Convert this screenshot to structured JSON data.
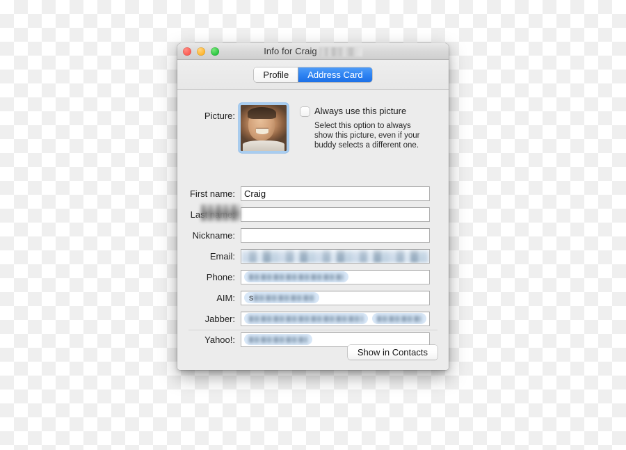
{
  "window": {
    "title_prefix": "Info for Craig",
    "title_redacted": true,
    "traffic_lights": [
      {
        "name": "close",
        "color": "#fc5b52"
      },
      {
        "name": "minimize",
        "color": "#feb52c"
      },
      {
        "name": "zoom",
        "color": "#27c53e"
      }
    ]
  },
  "tabs": [
    {
      "label": "Profile",
      "active": false
    },
    {
      "label": "Address Card",
      "active": true
    }
  ],
  "picture": {
    "label": "Picture:",
    "checkbox_label": "Always use this picture",
    "checked": false,
    "help_text": "Select this option to always show this picture, even if your buddy selects a different one."
  },
  "fields": [
    {
      "label": "First name:",
      "value": "Craig",
      "redacted": false,
      "kind": "text"
    },
    {
      "label": "Last name:",
      "value": "",
      "redacted": true,
      "kind": "overlay"
    },
    {
      "label": "Nickname:",
      "value": "",
      "redacted": false,
      "kind": "text"
    },
    {
      "label": "Email:",
      "value": "",
      "redacted": true,
      "kind": "fill"
    },
    {
      "label": "Phone:",
      "value": "",
      "redacted": true,
      "kind": "token",
      "token_width": 136
    },
    {
      "label": "AIM:",
      "value": "s",
      "redacted": true,
      "kind": "token",
      "token_width": 94
    },
    {
      "label": "Jabber:",
      "value": "",
      "redacted": true,
      "kind": "token2",
      "token_width": 185,
      "token2_width": 72
    },
    {
      "label": "Yahoo!:",
      "value": "",
      "redacted": true,
      "kind": "token",
      "token_width": 84
    }
  ],
  "footer": {
    "button_label": "Show in Contacts"
  },
  "colors": {
    "accent": "#2f84f2",
    "window_bg": "#ececec",
    "field_bg": "#ffffff",
    "token_bg": "#d8e7f7",
    "avatar_border": "#a8cdf0"
  }
}
